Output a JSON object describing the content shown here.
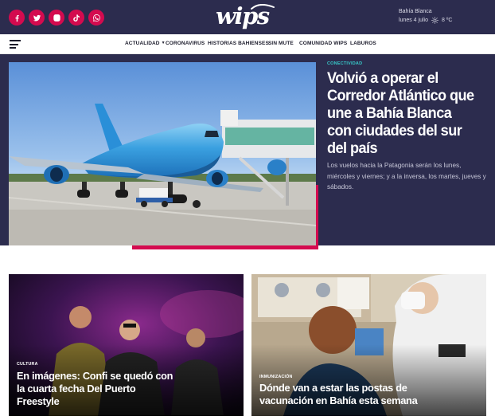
{
  "header": {
    "social_icons": [
      "facebook-icon",
      "twitter-icon",
      "instagram-icon",
      "tiktok-icon",
      "whatsapp-icon"
    ],
    "logo_text": "wips",
    "weather": {
      "city": "Bahía Blanca",
      "date": "lunes 4 julio",
      "temp": "8 ºC",
      "icon": "sun-icon"
    }
  },
  "nav": {
    "menu_icon": "hamburger-icon",
    "items": [
      {
        "label": "ACTUALIDAD",
        "has_dropdown": true
      },
      {
        "label": "CORONAVIRUS"
      },
      {
        "label": "HISTORIAS BAHIENSES"
      },
      {
        "label": "SIN MUTE"
      },
      {
        "label": "COMUNIDAD WIPS"
      },
      {
        "label": "LABUROS"
      }
    ]
  },
  "hero": {
    "tag": "CONECTIVIDAD",
    "title": "Volvió a operar el Corredor Atlántico que une a Bahía Blanca con ciudades del sur del país",
    "summary": "Los vuelos hacia la Patagonia serán los lunes, miércoles y viernes; y a la inversa, los martes, jueves y sábados.",
    "image_alt": "Aerolíneas Argentinas airplane at gate"
  },
  "cards": [
    {
      "tag": "CULTURA",
      "title": "En imágenes: Confi se quedó con la cuarta fecha Del Puerto Freestyle"
    },
    {
      "tag": "INMUNIZACIÓN",
      "title": "Dónde van a estar las postas de vacunación en Bahía esta semana"
    }
  ],
  "colors": {
    "brand_dark": "#2c2c4e",
    "accent": "#d40b4f",
    "tag_teal": "#37c8c8"
  }
}
